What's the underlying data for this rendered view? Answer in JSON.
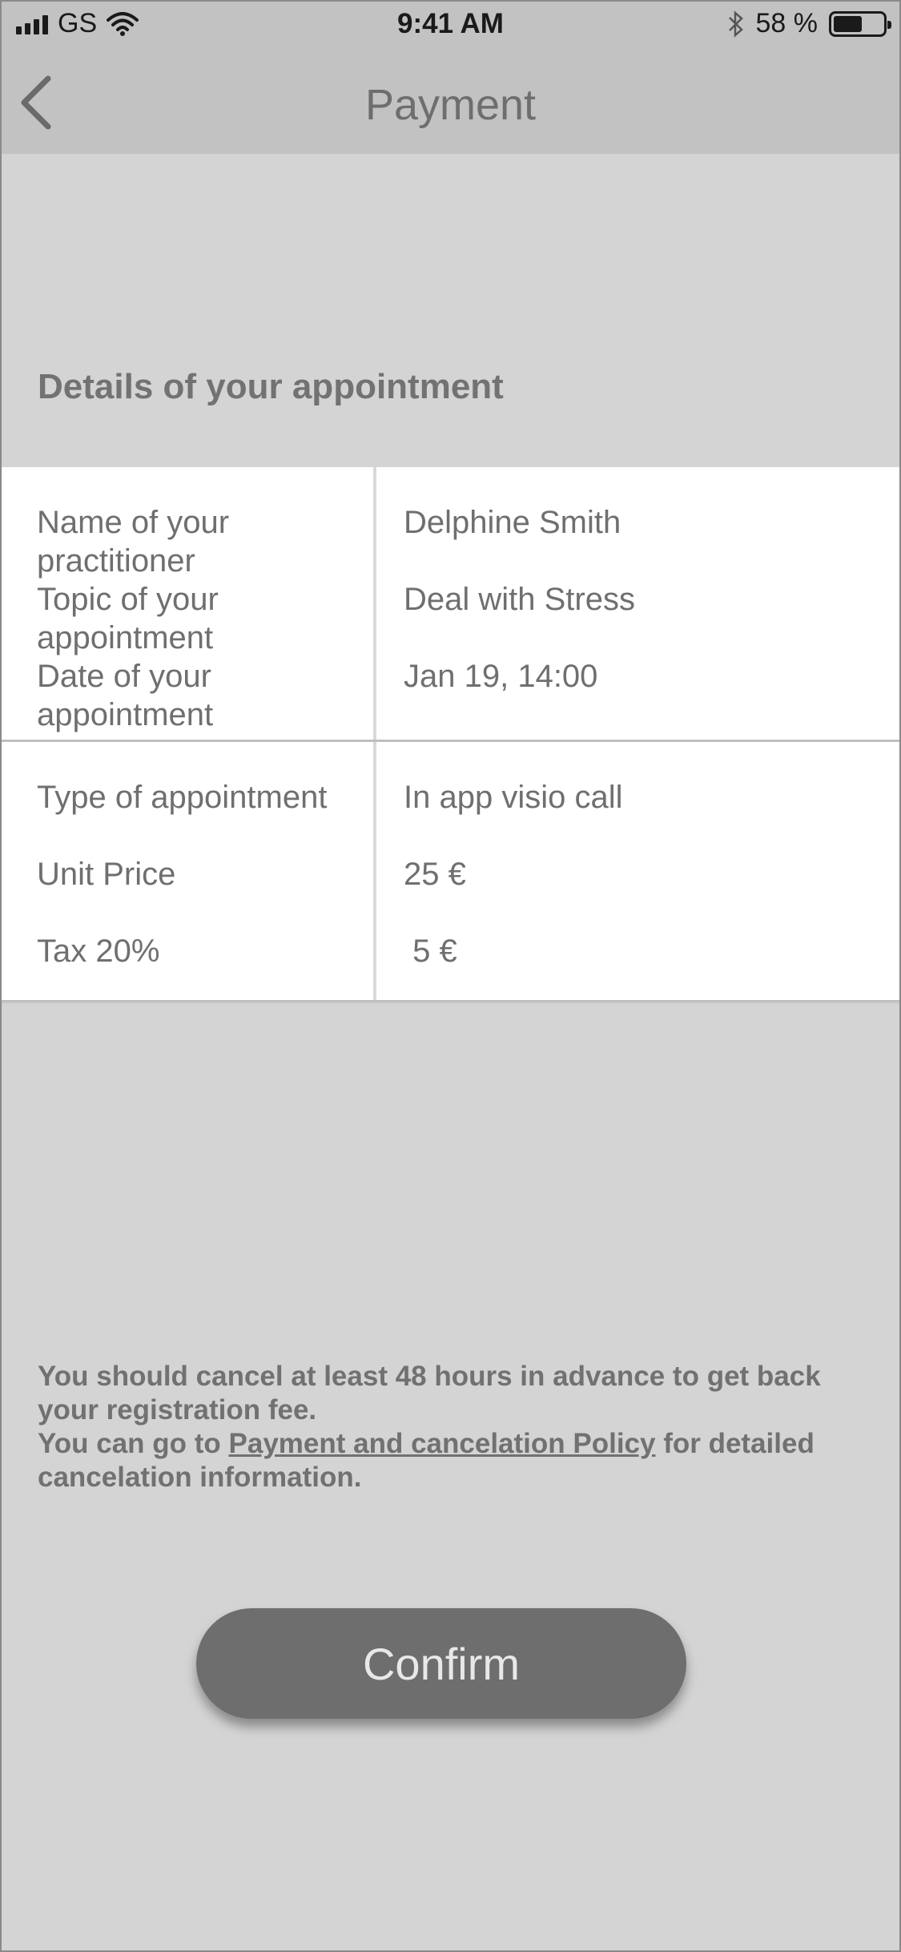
{
  "status_bar": {
    "carrier": "GS",
    "time": "9:41 AM",
    "battery_percent": "58 %",
    "battery_level": 0.58
  },
  "nav": {
    "title": "Payment"
  },
  "section_title": "Details of your appointment",
  "details": [
    {
      "label": "Name of your practitioner",
      "value": "Delphine Smith"
    },
    {
      "label": "Topic of your appointment",
      "value": "Deal with Stress"
    },
    {
      "label": "Date of your appointment",
      "value": "Jan 19, 14:00"
    }
  ],
  "pricing": [
    {
      "label": "Type of appointment",
      "value": "In app visio call"
    },
    {
      "label": "Unit Price",
      "value": "25 €"
    },
    {
      "label": "Tax 20%",
      "value": " 5 €"
    }
  ],
  "notice": {
    "line1": "You should cancel at least 48 hours in advance to get back your registration fee.",
    "line2_prefix": "You can go to ",
    "link": "Payment and cancelation Policy",
    "line2_suffix": " for detailed cancelation information."
  },
  "confirm_label": "Confirm"
}
